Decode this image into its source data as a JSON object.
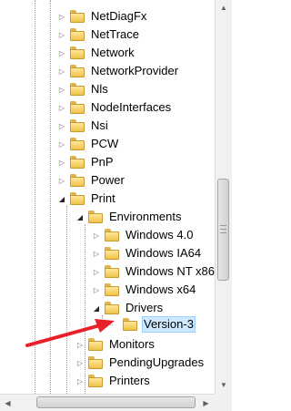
{
  "registry_tree": {
    "items": [
      {
        "label": "NetDiagFx",
        "expanded": false
      },
      {
        "label": "NetTrace",
        "expanded": false
      },
      {
        "label": "Network",
        "expanded": false
      },
      {
        "label": "NetworkProvider",
        "expanded": false
      },
      {
        "label": "Nls",
        "expanded": false
      },
      {
        "label": "NodeInterfaces",
        "expanded": false
      },
      {
        "label": "Nsi",
        "expanded": false
      },
      {
        "label": "PCW",
        "expanded": false
      },
      {
        "label": "PnP",
        "expanded": false
      },
      {
        "label": "Power",
        "expanded": false
      },
      {
        "label": "Print",
        "expanded": true
      },
      {
        "label": "Environments",
        "expanded": true
      },
      {
        "label": "Windows 4.0",
        "expanded": false
      },
      {
        "label": "Windows IA64",
        "expanded": false
      },
      {
        "label": "Windows NT x86",
        "expanded": false
      },
      {
        "label": "Windows x64",
        "expanded": false
      },
      {
        "label": "Drivers",
        "expanded": true
      },
      {
        "label": "Version-3",
        "selected": true
      },
      {
        "label": "Monitors",
        "expanded": false
      },
      {
        "label": "PendingUpgrades",
        "expanded": false
      },
      {
        "label": "Printers",
        "expanded": false
      }
    ]
  },
  "icons": {
    "folder": "folder-icon",
    "collapsed": "triangle-right-icon",
    "expanded": "triangle-down-icon"
  },
  "colors": {
    "folder": "#f0c24a",
    "selection": "#cde8ff",
    "annotation_arrow": "#e8202a"
  }
}
